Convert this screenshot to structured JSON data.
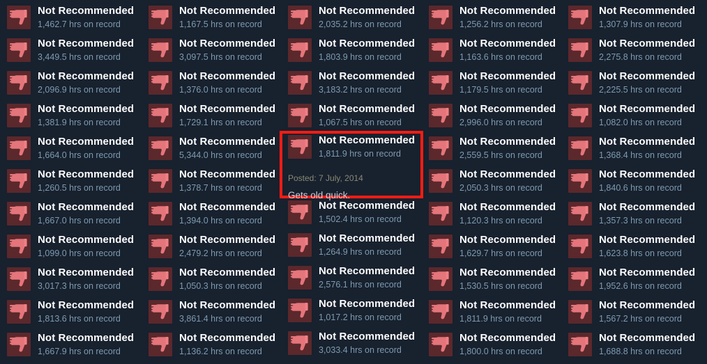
{
  "page": {
    "app": "steam-review-grid",
    "background_color": "#18212e",
    "verdict_label": "Not Recommended",
    "hours_suffix": "hrs on record",
    "icon": "thumbs-down-icon",
    "highlight_color": "#f91b13"
  },
  "columns": [
    {
      "index": 0,
      "reviews": [
        {
          "verdict": "Not Recommended",
          "hours": "1,462.7 hrs on record"
        },
        {
          "verdict": "Not Recommended",
          "hours": "3,449.5 hrs on record"
        },
        {
          "verdict": "Not Recommended",
          "hours": "2,096.9 hrs on record"
        },
        {
          "verdict": "Not Recommended",
          "hours": "1,381.9 hrs on record"
        },
        {
          "verdict": "Not Recommended",
          "hours": "1,664.0 hrs on record"
        },
        {
          "verdict": "Not Recommended",
          "hours": "1,260.5 hrs on record"
        },
        {
          "verdict": "Not Recommended",
          "hours": "1,667.0 hrs on record"
        },
        {
          "verdict": "Not Recommended",
          "hours": "1,099.0 hrs on record"
        },
        {
          "verdict": "Not Recommended",
          "hours": "3,017.3 hrs on record"
        },
        {
          "verdict": "Not Recommended",
          "hours": "1,813.6 hrs on record"
        },
        {
          "verdict": "Not Recommended",
          "hours": "1,667.9 hrs on record"
        }
      ]
    },
    {
      "index": 1,
      "reviews": [
        {
          "verdict": "Not Recommended",
          "hours": "1,167.5 hrs on record"
        },
        {
          "verdict": "Not Recommended",
          "hours": "3,097.5 hrs on record"
        },
        {
          "verdict": "Not Recommended",
          "hours": "1,376.0 hrs on record"
        },
        {
          "verdict": "Not Recommended",
          "hours": "1,729.1 hrs on record"
        },
        {
          "verdict": "Not Recommended",
          "hours": "5,344.0 hrs on record"
        },
        {
          "verdict": "Not Recommended",
          "hours": "1,378.7 hrs on record"
        },
        {
          "verdict": "Not Recommended",
          "hours": "1,394.0 hrs on record"
        },
        {
          "verdict": "Not Recommended",
          "hours": "2,479.2 hrs on record"
        },
        {
          "verdict": "Not Recommended",
          "hours": "1,050.3 hrs on record"
        },
        {
          "verdict": "Not Recommended",
          "hours": "3,861.4 hrs on record"
        },
        {
          "verdict": "Not Recommended",
          "hours": "1,136.2 hrs on record"
        }
      ]
    },
    {
      "index": 2,
      "reviews": [
        {
          "verdict": "Not Recommended",
          "hours": "2,035.2 hrs on record"
        },
        {
          "verdict": "Not Recommended",
          "hours": "1,803.9 hrs on record"
        },
        {
          "verdict": "Not Recommended",
          "hours": "3,183.2 hrs on record"
        },
        {
          "verdict": "Not Recommended",
          "hours": "1,067.5 hrs on record"
        },
        {
          "verdict": "Not Recommended",
          "hours": "1,811.9 hrs on record",
          "highlighted": true,
          "posted": "Posted: 7 July, 2014",
          "body": "Gets old quick."
        },
        {
          "verdict": "Not Recommended",
          "hours": "1,502.4 hrs on record"
        },
        {
          "verdict": "Not Recommended",
          "hours": "1,264.9 hrs on record"
        },
        {
          "verdict": "Not Recommended",
          "hours": "2,576.1 hrs on record"
        },
        {
          "verdict": "Not Recommended",
          "hours": "1,017.2 hrs on record"
        },
        {
          "verdict": "Not Recommended",
          "hours": "3,033.4 hrs on record"
        }
      ]
    },
    {
      "index": 3,
      "reviews": [
        {
          "verdict": "Not Recommended",
          "hours": "1,256.2 hrs on record"
        },
        {
          "verdict": "Not Recommended",
          "hours": "1,163.6 hrs on record"
        },
        {
          "verdict": "Not Recommended",
          "hours": "1,179.5 hrs on record"
        },
        {
          "verdict": "Not Recommended",
          "hours": "2,996.0 hrs on record"
        },
        {
          "verdict": "Not Recommended",
          "hours": "2,559.5 hrs on record"
        },
        {
          "verdict": "Not Recommended",
          "hours": "2,050.3 hrs on record"
        },
        {
          "verdict": "Not Recommended",
          "hours": "1,120.3 hrs on record"
        },
        {
          "verdict": "Not Recommended",
          "hours": "1,629.7 hrs on record"
        },
        {
          "verdict": "Not Recommended",
          "hours": "1,530.5 hrs on record"
        },
        {
          "verdict": "Not Recommended",
          "hours": "1,811.9 hrs on record"
        },
        {
          "verdict": "Not Recommended",
          "hours": "1,800.0 hrs on record"
        }
      ]
    },
    {
      "index": 4,
      "reviews": [
        {
          "verdict": "Not Recommended",
          "hours": "1,307.9 hrs on record"
        },
        {
          "verdict": "Not Recommended",
          "hours": "2,275.8 hrs on record"
        },
        {
          "verdict": "Not Recommended",
          "hours": "2,225.5 hrs on record"
        },
        {
          "verdict": "Not Recommended",
          "hours": "1,082.0 hrs on record"
        },
        {
          "verdict": "Not Recommended",
          "hours": "1,368.4 hrs on record"
        },
        {
          "verdict": "Not Recommended",
          "hours": "1,840.6 hrs on record"
        },
        {
          "verdict": "Not Recommended",
          "hours": "1,357.3 hrs on record"
        },
        {
          "verdict": "Not Recommended",
          "hours": "1,623.8 hrs on record"
        },
        {
          "verdict": "Not Recommended",
          "hours": "1,952.6 hrs on record"
        },
        {
          "verdict": "Not Recommended",
          "hours": "1,567.2 hrs on record"
        },
        {
          "verdict": "Not Recommended",
          "hours": "1,688.8 hrs on record"
        }
      ]
    }
  ]
}
